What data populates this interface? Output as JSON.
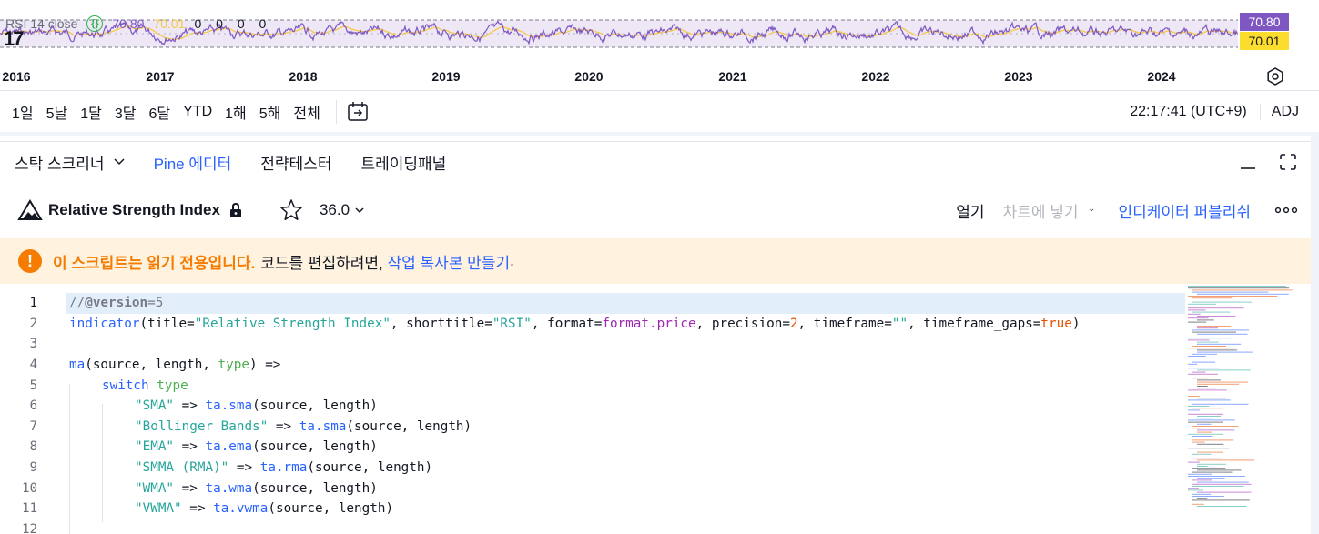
{
  "rsi_legend": {
    "title": "RSI 14 close",
    "rsi_value": "70.80",
    "ma_value": "70.01",
    "extra_values": "0 0 0 0"
  },
  "price_badges": {
    "rsi": "70.80",
    "ma": "70.01"
  },
  "colors": {
    "rsi_line": "#7e57c2",
    "ma_line": "#f7c948",
    "accent": "#2962ff",
    "warning": "#f57c00"
  },
  "time_axis": {
    "years": [
      "2016",
      "2017",
      "2018",
      "2019",
      "2020",
      "2021",
      "2022",
      "2023",
      "2024"
    ]
  },
  "range_bar": {
    "ranges": [
      "1일",
      "5날",
      "1달",
      "3달",
      "6달",
      "YTD",
      "1해",
      "5해",
      "전체"
    ],
    "clock": "22:17:41 (UTC+9)",
    "adj": "ADJ"
  },
  "panel_tabs": {
    "screener": "스탁 스크리너",
    "pine_prefix": "Pine",
    "pine_suffix": "에디터",
    "strategy": "전략테스터",
    "trading": "트레이딩패널"
  },
  "editor_header": {
    "title": "Relative Strength Index",
    "version": "36.0",
    "open": "열기",
    "add_to_chart": "차트에 넣기",
    "publish": "인디케이터 퍼블리쉬"
  },
  "warning": {
    "strong": "이 스크립트는 읽기 전용입니다.",
    "text": "코드를 편집하려면,",
    "link": "작업 복사본 만들기",
    "tail": "."
  },
  "code": {
    "line_numbers": [
      "1",
      "2",
      "3",
      "4",
      "5",
      "6",
      "7",
      "8",
      "9",
      "10",
      "11",
      "12"
    ],
    "l1_a": "//",
    "l1_b": "@version",
    "l1_c": "=5",
    "l2_a": "indicator",
    "l2_b": "(title=",
    "l2_c": "\"Relative Strength Index\"",
    "l2_d": ", shorttitle=",
    "l2_e": "\"RSI\"",
    "l2_f": ", format=",
    "l2_g": "format.price",
    "l2_h": ", precision=",
    "l2_i": "2",
    "l2_j": ", timeframe=",
    "l2_k": "\"\"",
    "l2_l": ", timeframe_gaps=",
    "l2_m": "true",
    "l2_n": ")",
    "l4_a": "ma",
    "l4_b": "(source, length, ",
    "l4_c": "type",
    "l4_d": ") =>",
    "l5_a": "switch",
    "l5_b": " type",
    "l6_a": "\"SMA\"",
    "l6_b": " => ",
    "l6_c": "ta.sma",
    "l6_d": "(source, length)",
    "l7_a": "\"Bollinger Bands\"",
    "l7_b": " => ",
    "l7_c": "ta.sma",
    "l7_d": "(source, length)",
    "l8_a": "\"EMA\"",
    "l8_b": " => ",
    "l8_c": "ta.ema",
    "l8_d": "(source, length)",
    "l9_a": "\"SMMA (RMA)\"",
    "l9_b": " => ",
    "l9_c": "ta.rma",
    "l9_d": "(source, length)",
    "l10_a": "\"WMA\"",
    "l10_b": " => ",
    "l10_c": "ta.wma",
    "l10_d": "(source, length)",
    "l11_a": "\"VWMA\"",
    "l11_b": " => ",
    "l11_c": "ta.vwma",
    "l11_d": "(source, length)"
  }
}
